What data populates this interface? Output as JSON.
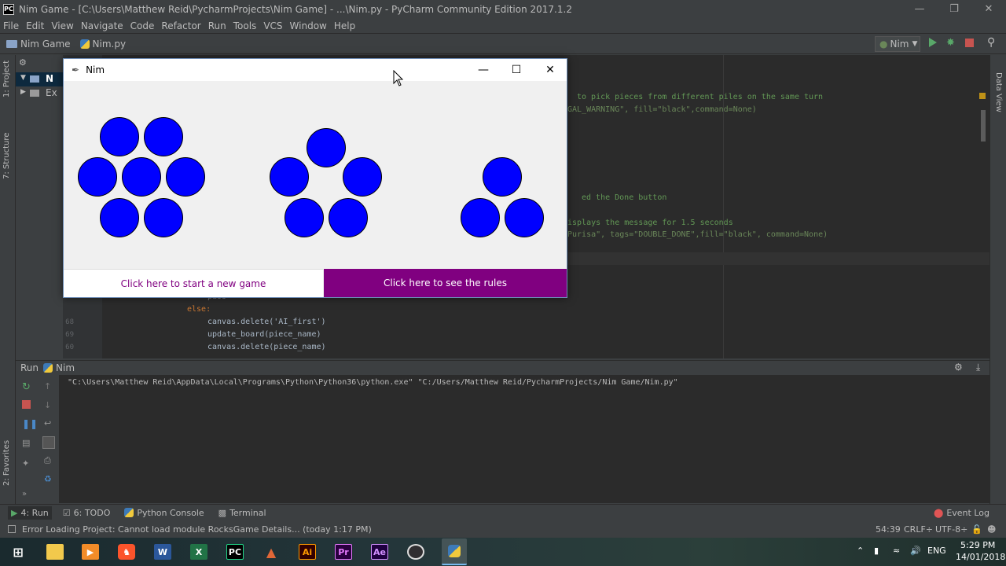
{
  "ide": {
    "window_title": "Nim Game - [C:\\Users\\Matthew Reid\\PycharmProjects\\Nim Game] - ...\\Nim.py - PyCharm Community Edition 2017.1.2",
    "menu": [
      "File",
      "Edit",
      "View",
      "Navigate",
      "Code",
      "Refactor",
      "Run",
      "Tools",
      "VCS",
      "Window",
      "Help"
    ],
    "breadcrumb_project": "Nim Game",
    "breadcrumb_file": "Nim.py",
    "run_config": "Nim",
    "left_tabs": [
      "1: Project",
      "7: Structure",
      "2: Favorites"
    ],
    "right_tab": "Data View",
    "project_tree": [
      "N",
      "Ex"
    ],
    "code_lines_top": [
      {
        "text": "to pick pieces from different piles on the same turn",
        "cls": "cmt"
      },
      {
        "text": "GAL_WARNING\", fill=\"black\",command=None)",
        "cls": "str"
      },
      {
        "text": "ed the Done button",
        "cls": "cmt"
      },
      {
        "text": "isplays the message for 1.5 seconds",
        "cls": "cmt"
      },
      {
        "text": "Purisa\", tags=\"DOUBLE_DONE\",fill=\"black\", command=None)",
        "cls": "str"
      }
    ],
    "code_lines_bottom": [
      {
        "num": "",
        "text": "pass"
      },
      {
        "num": "",
        "text": "else:"
      },
      {
        "num": "68",
        "text": "canvas.delete('AI_first')"
      },
      {
        "num": "69",
        "text": "update_board(piece_name)"
      },
      {
        "num": "60",
        "text": "canvas.delete(piece_name)"
      },
      {
        "num": "61",
        "text": ""
      }
    ],
    "run_panel_title": "Run",
    "run_panel_tab": "Nim",
    "run_command": "\"C:\\Users\\Matthew Reid\\AppData\\Local\\Programs\\Python\\Python36\\python.exe\" \"C:/Users/Matthew Reid/PycharmProjects/Nim Game/Nim.py\"",
    "tool_tabs": [
      "4: Run",
      "6: TODO",
      "Python Console",
      "Terminal"
    ],
    "event_log": "Event Log",
    "status_message": "Error Loading Project: Cannot load module RocksGame Details... (today 1:17 PM)",
    "status_position": "54:39",
    "status_line_sep": "CRLF÷",
    "status_encoding": "UTF-8÷"
  },
  "nim": {
    "window_title": "Nim",
    "new_game_label": "Click here to start a new game",
    "rules_label": "Click here to see the rules",
    "pile_counts": [
      7,
      5,
      3
    ]
  },
  "taskbar": {
    "lang": "ENG",
    "time": "5:29 PM",
    "date": "14/01/2018",
    "apps": [
      "start-icon",
      "file-explorer-icon",
      "media-player-icon",
      "brave-browser-icon",
      "word-icon",
      "excel-icon",
      "pycharm-icon",
      "matlab-icon",
      "illustrator-icon",
      "premiere-icon",
      "after-effects-icon",
      "obs-icon",
      "python-icon"
    ]
  },
  "colors": {
    "piece": "#0000ff",
    "rules_bg": "#800080",
    "new_game_text": "#800080",
    "ide_bg": "#3c3f41",
    "editor_bg": "#2b2b2b"
  }
}
